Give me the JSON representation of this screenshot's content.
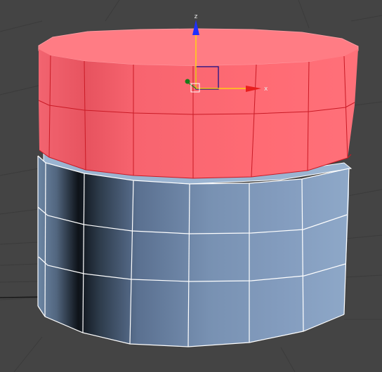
{
  "viewport": {
    "name": "perspective-viewport",
    "background": "#444444",
    "grid_color": "#3a3a3a"
  },
  "scene": {
    "selected_object": {
      "name": "selected-cylinder",
      "color": "#ff6b73",
      "edge_color": "#c91a25",
      "selected": true
    },
    "base_object": {
      "name": "base-cylinder",
      "color": "#7f97b8",
      "edge_color": "#ffffff",
      "selected": false
    }
  },
  "gizmo": {
    "z_label": "z",
    "x_label": "x",
    "z_color": "#1f2fff",
    "x_color": "#ff2a2a",
    "y_color": "#1a8a1a",
    "plane_color": "#ffe100"
  }
}
